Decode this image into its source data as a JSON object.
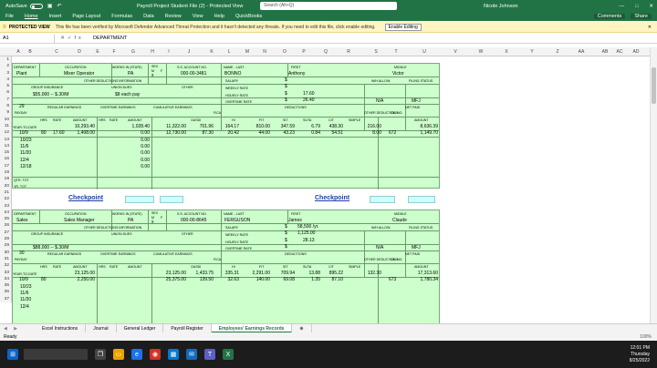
{
  "titlebar": {
    "autosave": "AutoSave",
    "autosave_state": "Off",
    "doc_title": "Payroll Project Student File (2) - Protected View",
    "search_placeholder": "Search (Alt+Q)",
    "user": "Nicole Johnson"
  },
  "ribbon": {
    "tabs": [
      "File",
      "Home",
      "Insert",
      "Page Layout",
      "Formulas",
      "Data",
      "Review",
      "View",
      "Help",
      "QuickBooks"
    ],
    "comments": "Comments",
    "share": "Share"
  },
  "protected_view": {
    "label": "PROTECTED VIEW",
    "message": "This file has been verified by Microsoft Defender Advanced Threat Protection and it hasn't detected any threats. If you need to edit this file, click enable editing.",
    "button": "Enable Editing"
  },
  "formula_bar": {
    "cell": "A1",
    "content": "DEPARTMENT"
  },
  "columns": [
    "A",
    "B",
    "C",
    "D",
    "E",
    "F",
    "G",
    "H",
    "I",
    "J",
    "K",
    "L",
    "M",
    "N",
    "O",
    "P",
    "Q",
    "R",
    "S",
    "T",
    "U",
    "V",
    "W",
    "X",
    "Y",
    "Z",
    "AA",
    "AB",
    "AC",
    "AD"
  ],
  "rows": [
    "1",
    "2",
    "3",
    "4",
    "5",
    "6",
    "7",
    "8",
    "9",
    "10",
    "11",
    "12",
    "13",
    "14",
    "15",
    "16",
    "17",
    "18",
    "19",
    "20",
    "21",
    "22",
    "23",
    "24",
    "25",
    "26",
    "27",
    "28",
    "29",
    "30",
    "31",
    "32",
    "33",
    "34",
    "35",
    "36",
    "37"
  ],
  "record1": {
    "department_hdr": "DEPARTMENT",
    "occupation_hdr": "OCCUPATION",
    "works_in_hdr": "WORKS IN (STATE)",
    "sex_hdr": "SEX",
    "m": "M",
    "f": "F",
    "ssn_hdr": "S.S. ACCOUNT NO.",
    "name_last_hdr": "NAME - LAST",
    "first_hdr": "FIRST",
    "middle_hdr": "MIDDLE",
    "department": "Plant",
    "occupation": "Mixer Operator",
    "state": "PA",
    "sex_mark": "x",
    "ssn": "000-00-3481",
    "last": "BONNO",
    "first": "Anthony",
    "middle": "Victor",
    "other_ded_info": "OTHER DEDUCTIONS INFORMATION",
    "group_ins": "GROUP INSURANCE",
    "union_dues": "UNION DUES",
    "other": "OTHER",
    "group_ins_val": "$55,000 -- $.30/M",
    "union_val": "$8 each pay",
    "salary": "SALARY",
    "weekly_rate": "WEEKLY RATE",
    "hourly_rate": "HOURLY RATE",
    "overtime_rate": "OVERTIME RATE",
    "dollar": "$",
    "hourly_val": "17.60",
    "ot_val": "26.40",
    "wh_allow": "W/H ALLOW.",
    "filing": "FILING STATUS",
    "wh_val": "N/A",
    "filing_val": "MFJ",
    "qtr": "29",
    "reg_earn": "REGULAR EARNINGS",
    "ot_earn": "OVERTIME EARNINGS",
    "cumul": "CUMULATIVE EARNINGS",
    "deductions": "DEDUCTIONS",
    "net_paid": "NET PAID",
    "payday": "PAYDAY",
    "fica": "FICA",
    "other_ded": "OTHER DEDUCTIONS",
    "ck_no": "CK. NO.",
    "hdrs": [
      "HRS",
      "RATE",
      "AMOUNT",
      "HRS",
      "RATE",
      "AMOUNT",
      "OASDI",
      "HI",
      "FIT",
      "SIT",
      "SUTA",
      "CIT",
      "SIMPLE",
      "AMOUNT"
    ],
    "year_to_date": "YEAR-TO-DATE",
    "ytd": [
      "10,293.40",
      "1,028.40",
      "11,322.00",
      "701.96",
      "164.17",
      "810.00",
      "347.59",
      "6.79",
      "438.30",
      "216.00",
      "8,636.39"
    ],
    "r11": [
      "10/9",
      "80",
      "17.60",
      "1,408.00",
      "0.00",
      "12,730.00",
      "87.30",
      "20.42",
      "44.00",
      "43.23",
      "0.84",
      "54.51",
      "8.00",
      "672",
      "1,149.70"
    ],
    "dates": [
      "10/23",
      "11/6",
      "11/20",
      "12/4",
      "12/18"
    ],
    "zero": "0.00",
    "qtr_tot": "QTR. TOT",
    "yr_tot": "YR. TOT"
  },
  "checkpoint": "Checkpoint",
  "record2": {
    "department": "Sales",
    "occupation": "Sales Manager",
    "state": "PA",
    "sex_mark": "x",
    "ssn": "000-00-8645",
    "last": "FERGUSON",
    "first": "James",
    "middle": "Claude",
    "group_ins_val": "$88,000 -- $.30/M",
    "salary_val": "58,500 /yr.",
    "weekly_val": "1,125.00",
    "hourly_val": "28.13",
    "wh_val": "N/A",
    "filing_val": "MFJ",
    "qtr": "30",
    "ytd": [
      "23,125.00",
      "23,125.00",
      "1,433.75",
      "335.31",
      "2,291.00",
      "709.94",
      "13.88",
      "895.22",
      "132.30",
      "17,313.60"
    ],
    "r33": [
      "10/9",
      "80",
      "2,250.00",
      "25,375.00",
      "139.50",
      "32.63",
      "140.00",
      "69.08",
      "1.35",
      "87.10",
      "673",
      "1,780.34"
    ],
    "dates": [
      "10/23",
      "11/6",
      "11/20",
      "12/4"
    ]
  },
  "sheets": [
    "Excel Instructions",
    "Journal",
    "General Ledger",
    "Payroll Register",
    "Employees' Earnings Records"
  ],
  "active_sheet": "Employees' Earnings Records",
  "status": {
    "ready": "Ready",
    "zoom": "100%"
  },
  "taskbar": {
    "time": "12:01 PM",
    "day": "Thursday",
    "date": "8/25/2022"
  }
}
